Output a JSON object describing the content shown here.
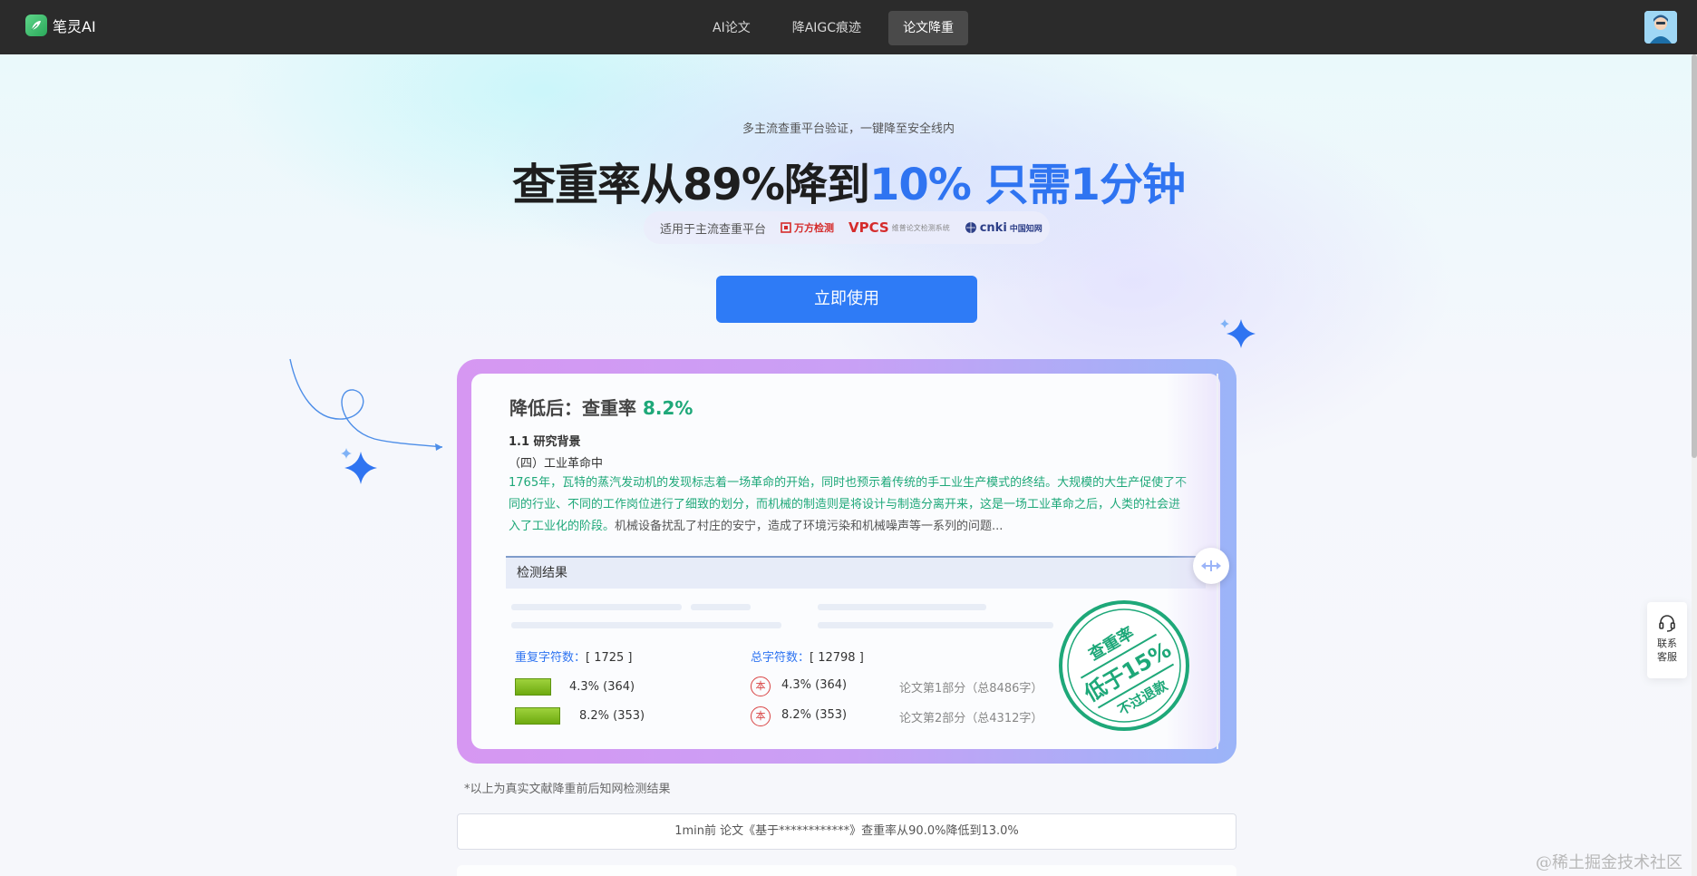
{
  "app": {
    "brand": "笔灵AI"
  },
  "nav": {
    "items": [
      {
        "label": "AI论文",
        "active": false
      },
      {
        "label": "降AIGC痕迹",
        "active": false
      },
      {
        "label": "论文降重",
        "active": true
      }
    ]
  },
  "hero": {
    "subtitle": "多主流查重平台验证，一键降至安全线内",
    "headline_dark": "查重率从89%降到",
    "headline_blue": "10% 只需1分钟",
    "platforms_label": "适用于主流查重平台",
    "platform_wanfang": "万方检测",
    "platform_vpcs": "VPCS",
    "platform_vpcs_cn": "维普论文检测系统",
    "platform_cnki": "cnki",
    "platform_cnki_cn": "中国知网",
    "cta": "立即使用"
  },
  "card": {
    "title_prefix": "降低后：查重率 ",
    "title_rate": "8.2%",
    "section_heading": "1.1 研究背景",
    "section_sub": "（四）工业革命中",
    "para_green": "1765年，瓦特的蒸汽发动机的发现标志着一场革命的开始，同时也预示着传统的手工业生产模式的终结。大规模的大生产促使了不同的行业、不同的工作岗位进行了细致的划分，而机械的制造则是将设计与制造分离开来，这是一场工业革命之后，人类的社会进入了工业化的阶段。",
    "para_plain": "机械设备扰乱了村庄的安宁，造成了环境污染和机械噪声等一系列的问题...",
    "result_title": "检测结果",
    "dup_label": "重复字符数：",
    "dup_value": "[ 1725 ]",
    "total_label": "总字符数：",
    "total_value": "[ 12798 ]",
    "rows_left": [
      {
        "text": "4.3% (364)",
        "fill": 0.043
      },
      {
        "text": "8.2% (353)",
        "fill": 0.082
      }
    ],
    "rows_right": [
      {
        "icon": "本",
        "text": "4.3% (364)",
        "note": "论文第1部分（总8486字）"
      },
      {
        "icon": "本",
        "text": "8.2% (353)",
        "note": "论文第2部分（总4312字）"
      }
    ],
    "stamp_top": "查重率",
    "stamp_mid": "低于15%",
    "stamp_bottom": "不过退款"
  },
  "footer": {
    "footnote": "*以上为真实文献降重前后知网检测结果",
    "ticker": "1min前 论文《基于************》查重率从90.0%降低到13.0%"
  },
  "support": {
    "label": "联系客服"
  },
  "watermark": "@稀土掘金技术社区",
  "colors": {
    "accent": "#2e7bf6",
    "green": "#1ea879",
    "nav_bg": "#2b2b2b",
    "stamp": "#1ea879"
  },
  "icons": [
    "feather-logo-icon",
    "avatar-icon",
    "sparkle-icon",
    "headset-icon",
    "drag-handle-icon",
    "ben-seal-icon"
  ]
}
